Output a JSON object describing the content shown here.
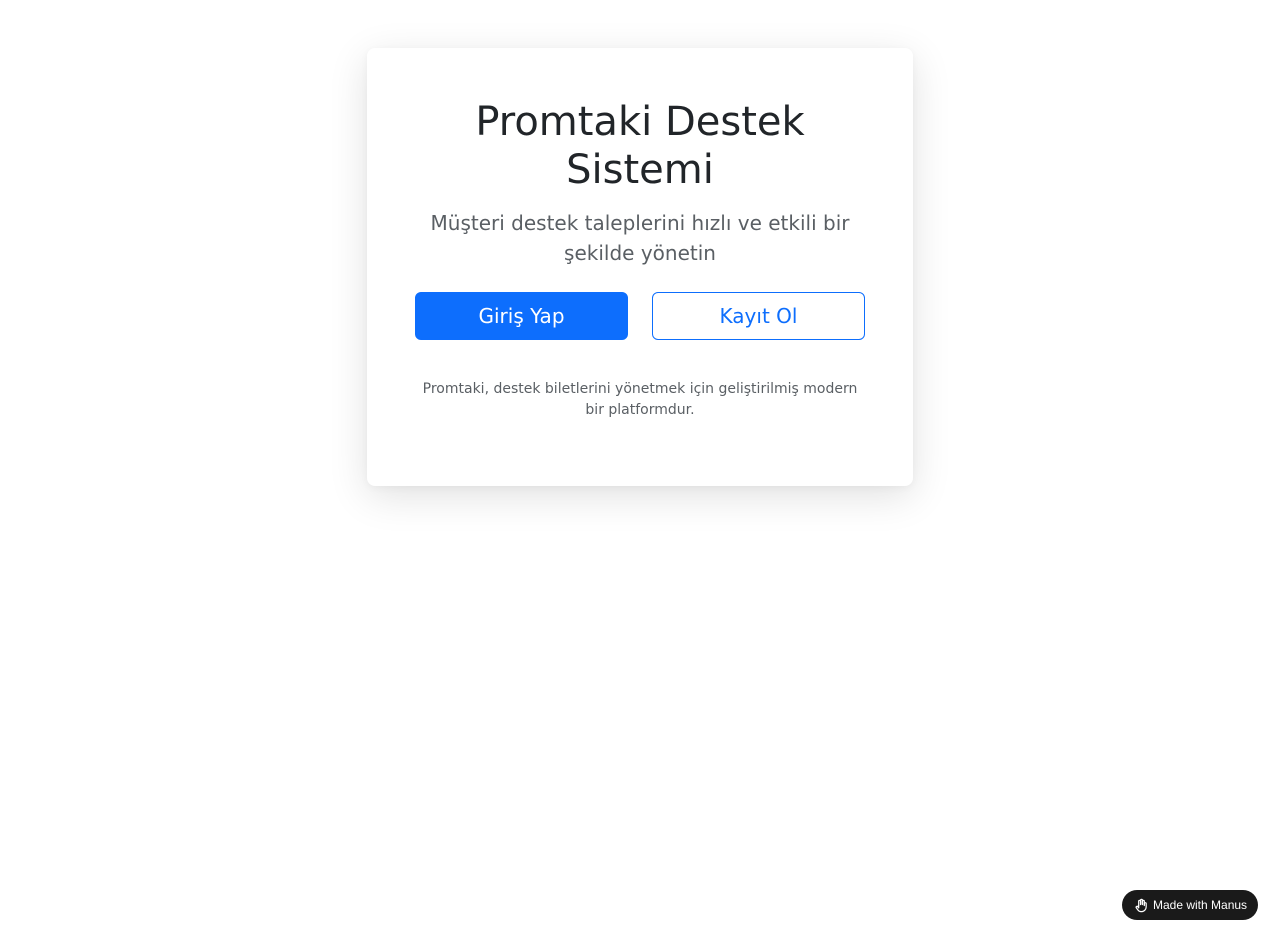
{
  "card": {
    "title": "Promtaki Destek Sistemi",
    "subtitle": "Müşteri destek taleplerini hızlı ve etkili bir şekilde yönetin",
    "login_label": "Giriş Yap",
    "register_label": "Kayıt Ol",
    "footnote": "Promtaki, destek biletlerini yönetmek için geliştirilmiş modern bir platformdur."
  },
  "badge": {
    "label": "Made with Manus",
    "icon": "manus-hand-icon"
  },
  "colors": {
    "primary": "#0d6efd",
    "text": "#212529",
    "muted": "#5a5f64",
    "badge_bg": "#1a1a1a"
  }
}
